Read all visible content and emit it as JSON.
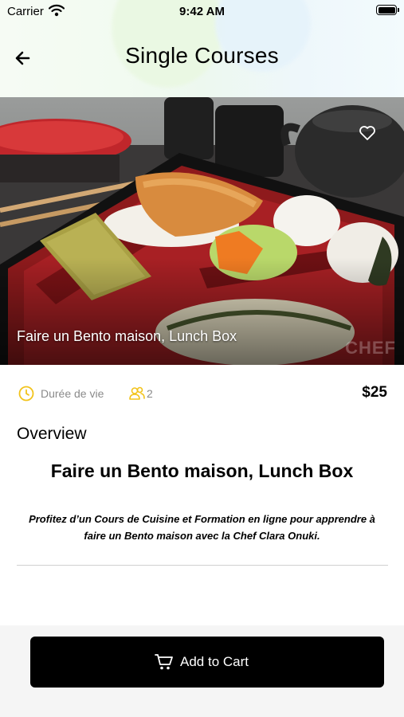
{
  "status_bar": {
    "carrier": "Carrier",
    "time": "9:42 AM"
  },
  "header": {
    "title": "Single Courses"
  },
  "hero": {
    "caption": "Faire un Bento maison, Lunch Box",
    "watermark": "CHEF"
  },
  "meta": {
    "duration_label": "Durée de vie",
    "participants": "2",
    "price": "$25"
  },
  "overview": {
    "label": "Overview",
    "title": "Faire un Bento maison, Lunch Box",
    "description": "Profitez d’un Cours de Cuisine et Formation en ligne pour apprendre à faire un Bento maison avec la Chef Clara Onuki."
  },
  "cart_button": {
    "label": "Add to Cart"
  },
  "colors": {
    "accent": "#f2c31b",
    "button": "#000000",
    "muted_text": "#8a8a8a"
  }
}
